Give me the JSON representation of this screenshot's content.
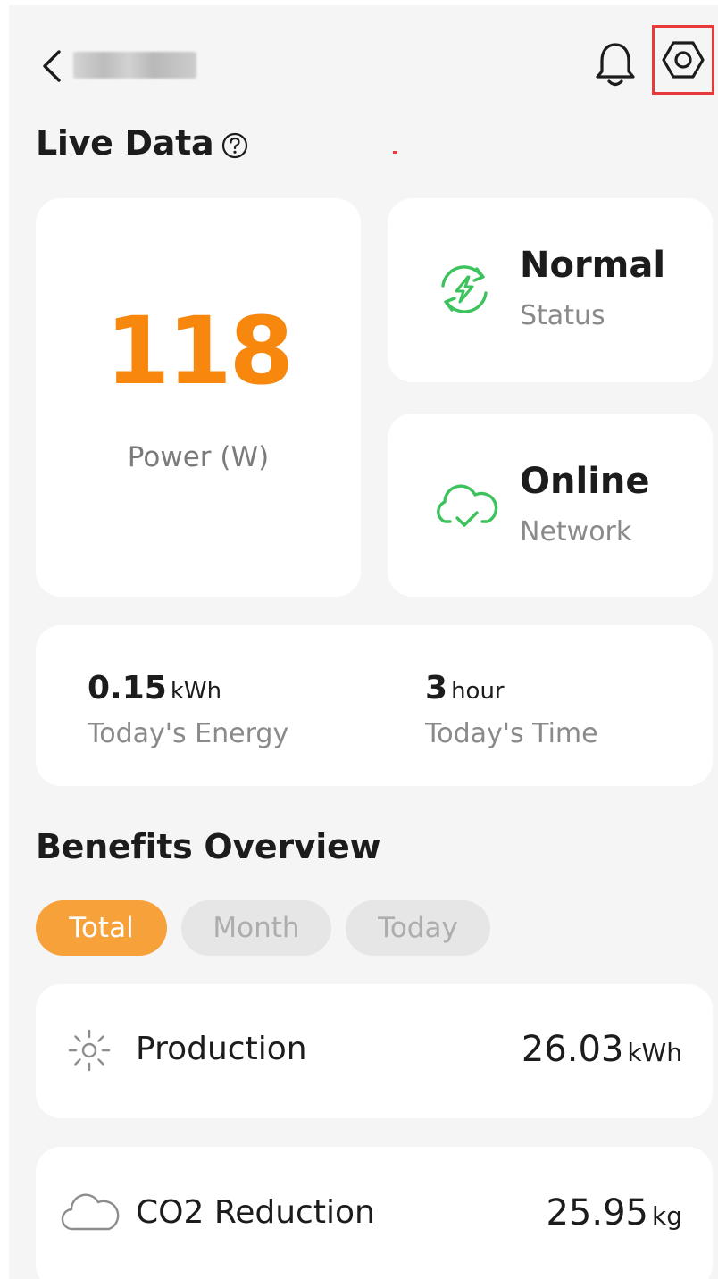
{
  "header": {
    "back_icon": "chevron-left-icon",
    "bell_icon": "bell-icon",
    "settings_icon": "settings-hexagon-icon"
  },
  "live_data": {
    "title": "Live Data",
    "help_icon": "question-circle-icon",
    "power": {
      "value": "118",
      "label": "Power (W)"
    },
    "status": {
      "value": "Normal",
      "label": "Status",
      "icon": "sync-lightning-icon"
    },
    "network": {
      "value": "Online",
      "label": "Network",
      "icon": "cloud-check-icon"
    },
    "today_energy": {
      "value": "0.15",
      "unit": "kWh",
      "label": "Today's Energy"
    },
    "today_time": {
      "value": "3",
      "unit": "hour",
      "label": "Today's Time"
    }
  },
  "benefits": {
    "title": "Benefits Overview",
    "tabs": [
      {
        "label": "Total",
        "active": true
      },
      {
        "label": "Month",
        "active": false
      },
      {
        "label": "Today",
        "active": false
      }
    ],
    "items": [
      {
        "label": "Production",
        "value": "26.03",
        "unit": "kWh",
        "icon": "sun-icon"
      },
      {
        "label": "CO2 Reduction",
        "value": "25.95",
        "unit": "kg",
        "icon": "cloud-icon"
      }
    ]
  },
  "colors": {
    "accent": "#f7870d",
    "tab_active": "#f7a13b",
    "success": "#3cc35d",
    "highlight": "#e83a3a",
    "background": "#f5f5f5"
  }
}
